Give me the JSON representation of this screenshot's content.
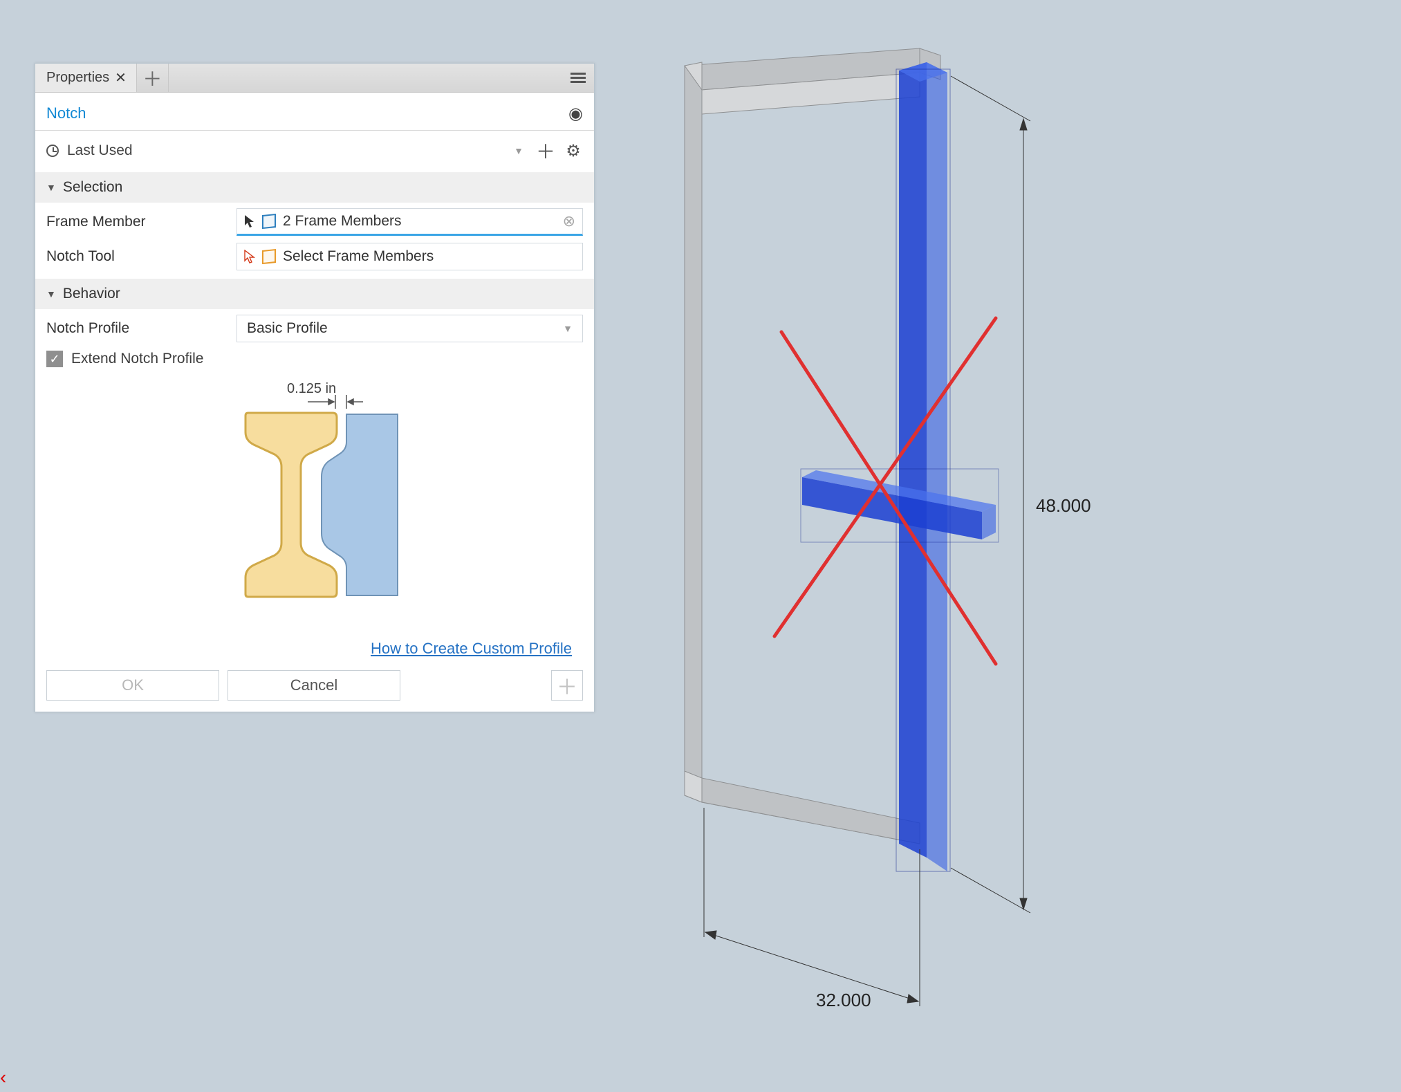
{
  "panel": {
    "tab_name": "Properties",
    "feature_name": "Notch",
    "preset_label": "Last Used",
    "sections": {
      "selection": {
        "title": "Selection",
        "rows": {
          "frame_member": {
            "label": "Frame Member",
            "value": "2 Frame Members"
          },
          "notch_tool": {
            "label": "Notch Tool",
            "value": "Select Frame Members"
          }
        }
      },
      "behavior": {
        "title": "Behavior",
        "rows": {
          "notch_profile": {
            "label": "Notch Profile",
            "value": "Basic Profile"
          },
          "extend": {
            "label": "Extend Notch Profile",
            "checked": true
          }
        }
      }
    },
    "diagram": {
      "gap_dim": "0.125 in"
    },
    "help_link": "How to Create Custom Profile",
    "buttons": {
      "ok": "OK",
      "cancel": "Cancel"
    }
  },
  "viewport": {
    "dim_height": "48.000",
    "dim_width": "32.000"
  }
}
